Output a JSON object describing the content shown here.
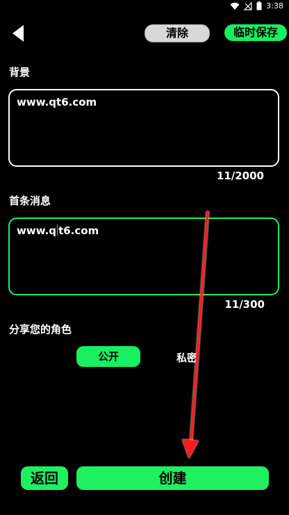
{
  "status_bar": {
    "time": "3:38",
    "icons": [
      "wifi-icon",
      "signal-icon",
      "battery-icon"
    ]
  },
  "header": {
    "back_icon": "chevron-left-icon",
    "clear_label": "清除",
    "temp_save_label": "临时保存"
  },
  "background": {
    "label": "背景",
    "value": "www.qt6.com",
    "counter": "11/2000"
  },
  "first_message": {
    "label": "首条消息",
    "value_before_cursor": "www.q",
    "value_after_cursor": "t6.com",
    "counter": "11/300"
  },
  "share": {
    "label": "分享您的角色",
    "options": [
      "公开",
      "私密"
    ],
    "selected": "公开"
  },
  "footer": {
    "back_label": "返回",
    "create_label": "创建"
  },
  "colors": {
    "background": "#000000",
    "accent_green": "#1ef05f",
    "clear_gray": "#d7d7d7",
    "annotation_red": "#ff1a1a"
  }
}
